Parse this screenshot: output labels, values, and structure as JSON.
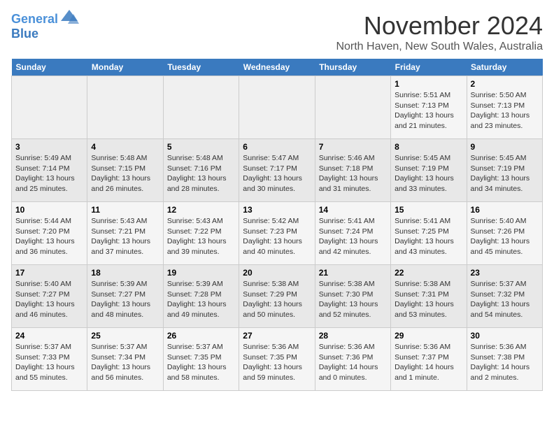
{
  "logo": {
    "line1": "General",
    "line2": "Blue",
    "tagline": ""
  },
  "title": "November 2024",
  "subtitle": "North Haven, New South Wales, Australia",
  "days_of_week": [
    "Sunday",
    "Monday",
    "Tuesday",
    "Wednesday",
    "Thursday",
    "Friday",
    "Saturday"
  ],
  "weeks": [
    [
      {
        "num": "",
        "info": ""
      },
      {
        "num": "",
        "info": ""
      },
      {
        "num": "",
        "info": ""
      },
      {
        "num": "",
        "info": ""
      },
      {
        "num": "",
        "info": ""
      },
      {
        "num": "1",
        "info": "Sunrise: 5:51 AM\nSunset: 7:13 PM\nDaylight: 13 hours\nand 21 minutes."
      },
      {
        "num": "2",
        "info": "Sunrise: 5:50 AM\nSunset: 7:13 PM\nDaylight: 13 hours\nand 23 minutes."
      }
    ],
    [
      {
        "num": "3",
        "info": "Sunrise: 5:49 AM\nSunset: 7:14 PM\nDaylight: 13 hours\nand 25 minutes."
      },
      {
        "num": "4",
        "info": "Sunrise: 5:48 AM\nSunset: 7:15 PM\nDaylight: 13 hours\nand 26 minutes."
      },
      {
        "num": "5",
        "info": "Sunrise: 5:48 AM\nSunset: 7:16 PM\nDaylight: 13 hours\nand 28 minutes."
      },
      {
        "num": "6",
        "info": "Sunrise: 5:47 AM\nSunset: 7:17 PM\nDaylight: 13 hours\nand 30 minutes."
      },
      {
        "num": "7",
        "info": "Sunrise: 5:46 AM\nSunset: 7:18 PM\nDaylight: 13 hours\nand 31 minutes."
      },
      {
        "num": "8",
        "info": "Sunrise: 5:45 AM\nSunset: 7:19 PM\nDaylight: 13 hours\nand 33 minutes."
      },
      {
        "num": "9",
        "info": "Sunrise: 5:45 AM\nSunset: 7:19 PM\nDaylight: 13 hours\nand 34 minutes."
      }
    ],
    [
      {
        "num": "10",
        "info": "Sunrise: 5:44 AM\nSunset: 7:20 PM\nDaylight: 13 hours\nand 36 minutes."
      },
      {
        "num": "11",
        "info": "Sunrise: 5:43 AM\nSunset: 7:21 PM\nDaylight: 13 hours\nand 37 minutes."
      },
      {
        "num": "12",
        "info": "Sunrise: 5:43 AM\nSunset: 7:22 PM\nDaylight: 13 hours\nand 39 minutes."
      },
      {
        "num": "13",
        "info": "Sunrise: 5:42 AM\nSunset: 7:23 PM\nDaylight: 13 hours\nand 40 minutes."
      },
      {
        "num": "14",
        "info": "Sunrise: 5:41 AM\nSunset: 7:24 PM\nDaylight: 13 hours\nand 42 minutes."
      },
      {
        "num": "15",
        "info": "Sunrise: 5:41 AM\nSunset: 7:25 PM\nDaylight: 13 hours\nand 43 minutes."
      },
      {
        "num": "16",
        "info": "Sunrise: 5:40 AM\nSunset: 7:26 PM\nDaylight: 13 hours\nand 45 minutes."
      }
    ],
    [
      {
        "num": "17",
        "info": "Sunrise: 5:40 AM\nSunset: 7:27 PM\nDaylight: 13 hours\nand 46 minutes."
      },
      {
        "num": "18",
        "info": "Sunrise: 5:39 AM\nSunset: 7:27 PM\nDaylight: 13 hours\nand 48 minutes."
      },
      {
        "num": "19",
        "info": "Sunrise: 5:39 AM\nSunset: 7:28 PM\nDaylight: 13 hours\nand 49 minutes."
      },
      {
        "num": "20",
        "info": "Sunrise: 5:38 AM\nSunset: 7:29 PM\nDaylight: 13 hours\nand 50 minutes."
      },
      {
        "num": "21",
        "info": "Sunrise: 5:38 AM\nSunset: 7:30 PM\nDaylight: 13 hours\nand 52 minutes."
      },
      {
        "num": "22",
        "info": "Sunrise: 5:38 AM\nSunset: 7:31 PM\nDaylight: 13 hours\nand 53 minutes."
      },
      {
        "num": "23",
        "info": "Sunrise: 5:37 AM\nSunset: 7:32 PM\nDaylight: 13 hours\nand 54 minutes."
      }
    ],
    [
      {
        "num": "24",
        "info": "Sunrise: 5:37 AM\nSunset: 7:33 PM\nDaylight: 13 hours\nand 55 minutes."
      },
      {
        "num": "25",
        "info": "Sunrise: 5:37 AM\nSunset: 7:34 PM\nDaylight: 13 hours\nand 56 minutes."
      },
      {
        "num": "26",
        "info": "Sunrise: 5:37 AM\nSunset: 7:35 PM\nDaylight: 13 hours\nand 58 minutes."
      },
      {
        "num": "27",
        "info": "Sunrise: 5:36 AM\nSunset: 7:35 PM\nDaylight: 13 hours\nand 59 minutes."
      },
      {
        "num": "28",
        "info": "Sunrise: 5:36 AM\nSunset: 7:36 PM\nDaylight: 14 hours\nand 0 minutes."
      },
      {
        "num": "29",
        "info": "Sunrise: 5:36 AM\nSunset: 7:37 PM\nDaylight: 14 hours\nand 1 minute."
      },
      {
        "num": "30",
        "info": "Sunrise: 5:36 AM\nSunset: 7:38 PM\nDaylight: 14 hours\nand 2 minutes."
      }
    ]
  ]
}
